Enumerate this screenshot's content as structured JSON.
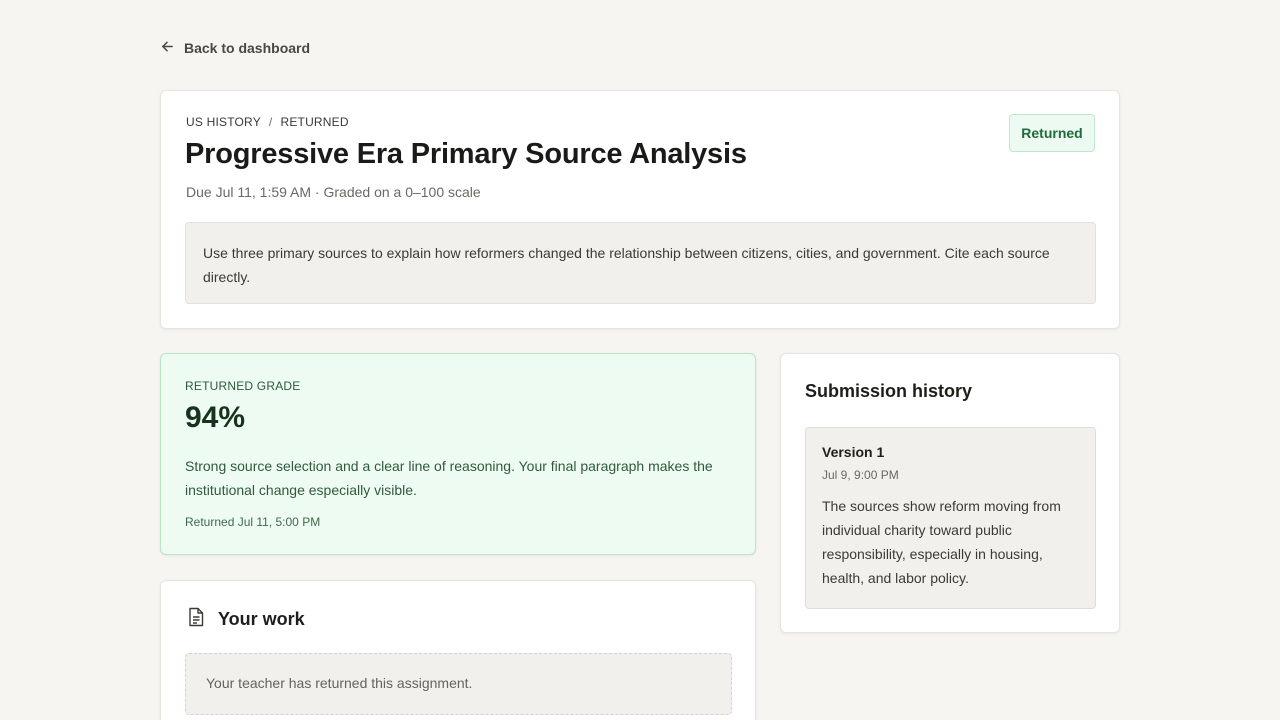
{
  "nav": {
    "back_label": "Back to dashboard"
  },
  "assignment": {
    "course": "US HISTORY",
    "separator": "/",
    "state": "RETURNED",
    "title": "Progressive Era Primary Source Analysis",
    "meta": "Due Jul 11, 1:59 AM · Graded on a 0–100 scale",
    "status_badge": "Returned",
    "instructions": "Use three primary sources to explain how reformers changed the relationship between citizens, cities, and government. Cite each source directly."
  },
  "grade": {
    "label": "RETURNED GRADE",
    "value": "94%",
    "feedback": "Strong source selection and a clear line of reasoning. Your final paragraph makes the institutional change especially visible.",
    "returned_at": "Returned Jul 11, 5:00 PM"
  },
  "work": {
    "title": "Your work",
    "notice": "Your teacher has returned this assignment."
  },
  "history": {
    "title": "Submission history",
    "versions": [
      {
        "name": "Version 1",
        "date": "Jul 9, 9:00 PM",
        "text": "The sources show reform moving from individual charity toward public responsibility, especially in housing, health, and labor policy."
      }
    ]
  },
  "icons": {
    "back": "arrow-left-icon",
    "work": "document-icon"
  },
  "colors": {
    "background": "#f7f5f1",
    "success_bg": "#eefbf2",
    "success_border": "#b9e4c6",
    "success_text": "#1f6b3a"
  }
}
